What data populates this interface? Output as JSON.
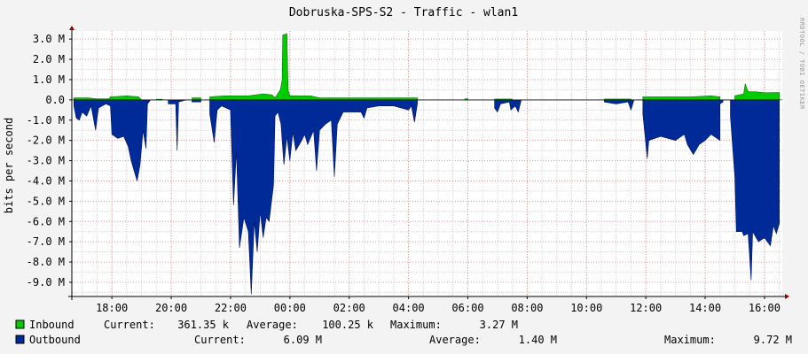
{
  "chart_data": {
    "type": "area",
    "title": "Dobruska-SPS-S2 - Traffic - wlan1",
    "ylabel": "bits per second",
    "watermark": "RRDTOOL / TOBI OETIKER",
    "ylim": [
      -9.7,
      3.4
    ],
    "yticks": [
      {
        "v": 3,
        "label": "3.0 M"
      },
      {
        "v": 2,
        "label": "2.0 M"
      },
      {
        "v": 1,
        "label": "1.0 M"
      },
      {
        "v": 0,
        "label": "0.0"
      },
      {
        "v": -1,
        "label": "-1.0 M"
      },
      {
        "v": -2,
        "label": "-2.0 M"
      },
      {
        "v": -3,
        "label": "-3.0 M"
      },
      {
        "v": -4,
        "label": "-4.0 M"
      },
      {
        "v": -5,
        "label": "-5.0 M"
      },
      {
        "v": -6,
        "label": "-6.0 M"
      },
      {
        "v": -7,
        "label": "-7.0 M"
      },
      {
        "v": -8,
        "label": "-8.0 M"
      },
      {
        "v": -9,
        "label": "-9.0 M"
      }
    ],
    "xlim": [
      16.65,
      40.6
    ],
    "xticks": [
      {
        "v": 18,
        "label": "18:00"
      },
      {
        "v": 20,
        "label": "20:00"
      },
      {
        "v": 22,
        "label": "22:00"
      },
      {
        "v": 24,
        "label": "00:00"
      },
      {
        "v": 26,
        "label": "02:00"
      },
      {
        "v": 28,
        "label": "04:00"
      },
      {
        "v": 30,
        "label": "06:00"
      },
      {
        "v": 32,
        "label": "08:00"
      },
      {
        "v": 34,
        "label": "10:00"
      },
      {
        "v": 36,
        "label": "12:00"
      },
      {
        "v": 38,
        "label": "14:00"
      },
      {
        "v": 40,
        "label": "16:00"
      }
    ],
    "grid": true,
    "series": [
      {
        "name": "Inbound",
        "color": "#00cc00",
        "border": "#007700",
        "points": [
          [
            16.72,
            0
          ],
          [
            16.72,
            0.1
          ],
          [
            17.2,
            0.1
          ],
          [
            17.5,
            0.05
          ],
          [
            17.9,
            0.05
          ],
          [
            17.95,
            0.15
          ],
          [
            18.5,
            0.2
          ],
          [
            18.9,
            0.15
          ],
          [
            19.0,
            0
          ],
          [
            19.5,
            0
          ],
          [
            19.5,
            0.03
          ],
          [
            19.7,
            0.03
          ],
          [
            19.7,
            0
          ],
          [
            20.7,
            0
          ],
          [
            20.7,
            0.1
          ],
          [
            21.0,
            0.1
          ],
          [
            21.0,
            0
          ],
          [
            21.3,
            0
          ],
          [
            21.3,
            0.15
          ],
          [
            21.8,
            0.2
          ],
          [
            22.6,
            0.2
          ],
          [
            23.1,
            0.3
          ],
          [
            23.4,
            0.25
          ],
          [
            23.5,
            0.1
          ],
          [
            23.68,
            0.5
          ],
          [
            23.74,
            1.0
          ],
          [
            23.76,
            3.2
          ],
          [
            23.9,
            3.27
          ],
          [
            23.94,
            0.5
          ],
          [
            24.0,
            0.2
          ],
          [
            24.7,
            0.2
          ],
          [
            25.0,
            0.1
          ],
          [
            28.3,
            0.1
          ],
          [
            28.3,
            0
          ],
          [
            29.9,
            0
          ],
          [
            29.9,
            0.05
          ],
          [
            30.0,
            0.05
          ],
          [
            30.0,
            0
          ],
          [
            30.9,
            0
          ],
          [
            30.9,
            0.04
          ],
          [
            31.5,
            0.04
          ],
          [
            31.5,
            0
          ],
          [
            34.6,
            0
          ],
          [
            34.6,
            0.04
          ],
          [
            35.5,
            0.04
          ],
          [
            35.5,
            0
          ],
          [
            35.9,
            0
          ],
          [
            35.9,
            0.15
          ],
          [
            37.5,
            0.15
          ],
          [
            38.2,
            0.2
          ],
          [
            38.5,
            0.15
          ],
          [
            38.5,
            0
          ],
          [
            39.0,
            0
          ],
          [
            39.0,
            0.2
          ],
          [
            39.3,
            0.3
          ],
          [
            39.35,
            0.8
          ],
          [
            39.45,
            0.4
          ],
          [
            39.7,
            0.4
          ],
          [
            40.0,
            0.35
          ],
          [
            40.5,
            0.36
          ],
          [
            40.5,
            0
          ]
        ]
      },
      {
        "name": "Outbound",
        "color": "#002a97",
        "border": "#001560",
        "points": [
          [
            16.72,
            0
          ],
          [
            16.72,
            -0.3
          ],
          [
            16.8,
            -0.9
          ],
          [
            16.9,
            -1.0
          ],
          [
            17.0,
            -0.6
          ],
          [
            17.15,
            -0.8
          ],
          [
            17.3,
            -0.3
          ],
          [
            17.45,
            -1.5
          ],
          [
            17.55,
            -0.4
          ],
          [
            17.8,
            -0.2
          ],
          [
            17.95,
            -0.3
          ],
          [
            18.0,
            -1.7
          ],
          [
            18.2,
            -1.9
          ],
          [
            18.4,
            -1.8
          ],
          [
            18.55,
            -2.3
          ],
          [
            18.65,
            -3.0
          ],
          [
            18.75,
            -3.5
          ],
          [
            18.85,
            -4.0
          ],
          [
            18.95,
            -3.2
          ],
          [
            19.05,
            -1.5
          ],
          [
            19.15,
            -2.4
          ],
          [
            19.2,
            -0.2
          ],
          [
            19.3,
            0
          ],
          [
            19.9,
            0
          ],
          [
            19.9,
            -0.2
          ],
          [
            20.15,
            -0.2
          ],
          [
            20.2,
            -2.5
          ],
          [
            20.25,
            -0.1
          ],
          [
            20.5,
            0
          ],
          [
            20.7,
            0
          ],
          [
            20.7,
            -0.1
          ],
          [
            21.0,
            -0.1
          ],
          [
            21.0,
            0
          ],
          [
            21.3,
            0
          ],
          [
            21.3,
            -0.7
          ],
          [
            21.45,
            -2.1
          ],
          [
            21.55,
            -0.5
          ],
          [
            21.7,
            -0.3
          ],
          [
            22.0,
            -0.5
          ],
          [
            22.1,
            -5.2
          ],
          [
            22.2,
            -2.5
          ],
          [
            22.3,
            -7.3
          ],
          [
            22.45,
            -5.8
          ],
          [
            22.6,
            -6.5
          ],
          [
            22.7,
            -9.6
          ],
          [
            22.8,
            -6.0
          ],
          [
            22.9,
            -7.5
          ],
          [
            23.0,
            -5.5
          ],
          [
            23.1,
            -6.8
          ],
          [
            23.2,
            -5.8
          ],
          [
            23.3,
            -6.0
          ],
          [
            23.45,
            -4.2
          ],
          [
            23.5,
            -0.8
          ],
          [
            23.6,
            -0.6
          ],
          [
            23.7,
            -1.2
          ],
          [
            23.8,
            -3.2
          ],
          [
            23.9,
            -1.8
          ],
          [
            24.0,
            -3.0
          ],
          [
            24.1,
            -1.6
          ],
          [
            24.2,
            -2.5
          ],
          [
            24.4,
            -2.0
          ],
          [
            24.5,
            -1.7
          ],
          [
            24.6,
            -2.2
          ],
          [
            24.8,
            -1.5
          ],
          [
            24.9,
            -3.5
          ],
          [
            25.0,
            -1.5
          ],
          [
            25.2,
            -1.2
          ],
          [
            25.4,
            -1.0
          ],
          [
            25.5,
            -3.8
          ],
          [
            25.6,
            -1.2
          ],
          [
            25.8,
            -0.6
          ],
          [
            26.0,
            -0.6
          ],
          [
            26.4,
            -0.6
          ],
          [
            26.5,
            -0.9
          ],
          [
            26.6,
            -0.4
          ],
          [
            27.0,
            -0.3
          ],
          [
            27.5,
            -0.3
          ],
          [
            28.0,
            -0.5
          ],
          [
            28.1,
            -0.3
          ],
          [
            28.2,
            -1.1
          ],
          [
            28.3,
            -0.2
          ],
          [
            28.3,
            0
          ],
          [
            30.9,
            0
          ],
          [
            30.9,
            -0.4
          ],
          [
            31.0,
            -0.6
          ],
          [
            31.1,
            -0.2
          ],
          [
            31.4,
            -0.1
          ],
          [
            31.45,
            -0.5
          ],
          [
            31.6,
            -0.3
          ],
          [
            31.7,
            -0.6
          ],
          [
            31.8,
            0
          ],
          [
            34.6,
            0
          ],
          [
            34.6,
            -0.1
          ],
          [
            35.0,
            -0.2
          ],
          [
            35.4,
            -0.1
          ],
          [
            35.5,
            -0.5
          ],
          [
            35.6,
            0
          ],
          [
            35.9,
            0
          ],
          [
            35.9,
            -0.7
          ],
          [
            36.05,
            -2.9
          ],
          [
            36.1,
            -2.0
          ],
          [
            36.5,
            -1.8
          ],
          [
            37.0,
            -2.0
          ],
          [
            37.3,
            -1.7
          ],
          [
            37.4,
            -2.2
          ],
          [
            37.6,
            -2.7
          ],
          [
            37.8,
            -2.2
          ],
          [
            38.0,
            -2.0
          ],
          [
            38.2,
            -1.7
          ],
          [
            38.5,
            -2.0
          ],
          [
            38.5,
            -0.2
          ],
          [
            38.6,
            -0.1
          ],
          [
            38.6,
            0
          ],
          [
            38.85,
            0
          ],
          [
            38.85,
            -0.8
          ],
          [
            39.0,
            -3.8
          ],
          [
            39.05,
            -6.5
          ],
          [
            39.25,
            -6.5
          ],
          [
            39.3,
            -6.7
          ],
          [
            39.45,
            -6.6
          ],
          [
            39.55,
            -8.9
          ],
          [
            39.6,
            -6.5
          ],
          [
            39.8,
            -7.0
          ],
          [
            40.0,
            -6.8
          ],
          [
            40.2,
            -7.2
          ],
          [
            40.3,
            -6.2
          ],
          [
            40.4,
            -6.6
          ],
          [
            40.5,
            -6.1
          ],
          [
            40.5,
            0
          ]
        ]
      }
    ]
  },
  "legend": {
    "inbound": {
      "name": "Inbound",
      "color": "#00cc00",
      "current_label": "Current:",
      "current_value": "361.35 k",
      "average_label": "Average:",
      "average_value": "100.25 k",
      "maximum_label": "Maximum:",
      "maximum_value": "3.27 M"
    },
    "outbound": {
      "name": "Outbound",
      "color": "#002a97",
      "current_label": "Current:",
      "current_value": "6.09 M",
      "average_label": "Average:",
      "average_value": "1.40 M",
      "maximum_label": "Maximum:",
      "maximum_value": "9.72 M"
    }
  }
}
